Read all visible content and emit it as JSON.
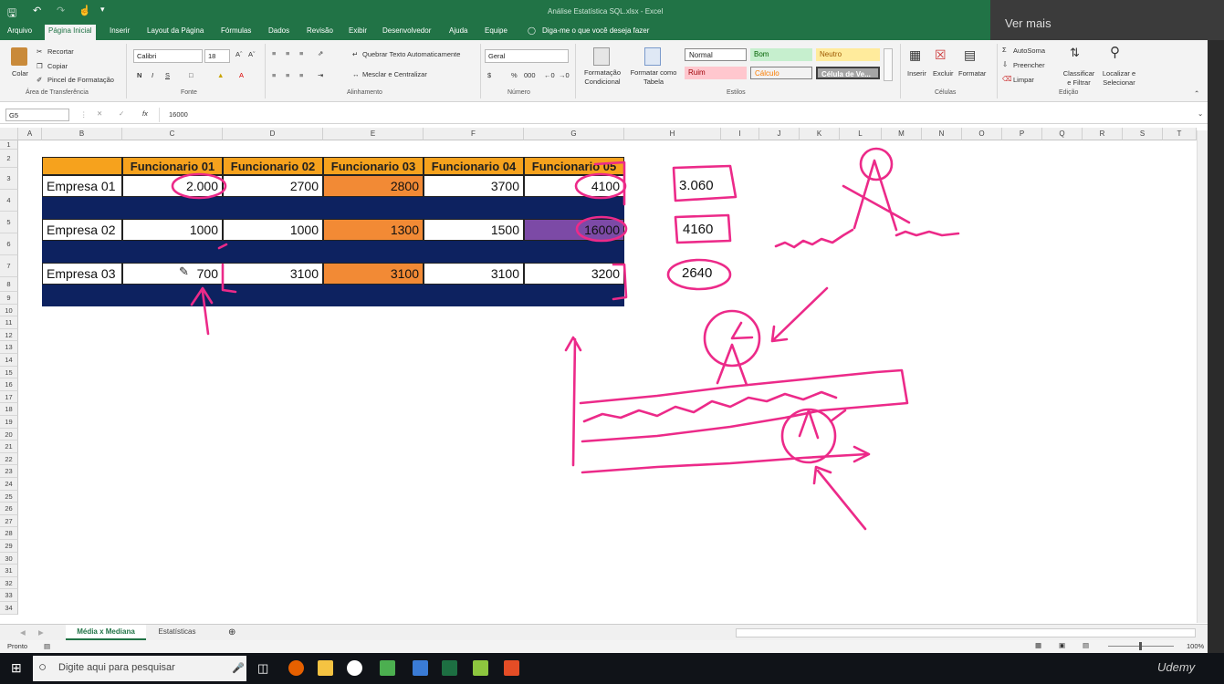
{
  "window": {
    "title": "Análise Estatística SQL.xlsx - Excel",
    "ver_mais": "Ver mais"
  },
  "ribbon_tabs": [
    "Arquivo",
    "Página Inicial",
    "Inserir",
    "Layout da Página",
    "Fórmulas",
    "Dados",
    "Revisão",
    "Exibir",
    "Desenvolvedor",
    "Ajuda",
    "Equipe"
  ],
  "tell_me": "Diga-me o que você deseja fazer",
  "clipboard": {
    "paste": "Colar",
    "cut": "Recortar",
    "copy": "Copiar",
    "format_painter": "Pincel de Formatação",
    "group": "Área de Transferência"
  },
  "font": {
    "name": "Calibri",
    "size": "18",
    "group": "Fonte"
  },
  "alignment": {
    "wrap": "Quebrar Texto Automaticamente",
    "merge": "Mesclar e Centralizar",
    "group": "Alinhamento"
  },
  "number": {
    "format": "Geral",
    "group": "Número"
  },
  "styles": {
    "cond_format": "Formatação Condicional",
    "format_table": "Formatar como Tabela",
    "normal": "Normal",
    "bom": "Bom",
    "neutro": "Neutro",
    "ruim": "Ruim",
    "calculo": "Cálculo",
    "celula": "Célula de Ve...",
    "group": "Estilos"
  },
  "cells": {
    "insert": "Inserir",
    "delete": "Excluir",
    "format": "Formatar",
    "group": "Células"
  },
  "editing": {
    "autosum": "AutoSoma",
    "fill": "Preencher",
    "clear": "Limpar",
    "sort": "Classificar e Filtrar",
    "find": "Localizar e Selecionar",
    "group": "Edição"
  },
  "formula_bar": {
    "name_box": "G5",
    "fx": "fx",
    "value": "16000"
  },
  "columns": [
    "A",
    "B",
    "C",
    "D",
    "E",
    "F",
    "G",
    "H",
    "I",
    "J",
    "K",
    "L",
    "M",
    "N",
    "O",
    "P",
    "Q",
    "R",
    "S",
    "T"
  ],
  "rows": [
    "1",
    "2",
    "3",
    "4",
    "5",
    "6",
    "7",
    "8",
    "9",
    "10",
    "11",
    "12",
    "13",
    "14",
    "15",
    "16",
    "17",
    "18",
    "19",
    "20",
    "21",
    "22",
    "23",
    "24",
    "25",
    "26",
    "27",
    "28",
    "29",
    "30",
    "31",
    "32",
    "33",
    "34"
  ],
  "table": {
    "headers": [
      "Funcionario 01",
      "Funcionario 02",
      "Funcionario 03",
      "Funcionario 04",
      "Funcionario 05"
    ],
    "rows": [
      {
        "label": "Empresa 01",
        "values": [
          "2.000",
          "2700",
          "2800",
          "3700",
          "4100"
        ]
      },
      {
        "label": "Empresa 02",
        "values": [
          "1000",
          "1000",
          "1300",
          "1500",
          "16000"
        ]
      },
      {
        "label": "Empresa 03",
        "values": [
          "700",
          "3100",
          "3100",
          "3100",
          "3200"
        ]
      }
    ]
  },
  "side_values": [
    "3.060",
    "4160",
    "2640"
  ],
  "sheet_tabs": [
    "Média x Mediana",
    "Estatísticas"
  ],
  "status": {
    "ready": "Pronto",
    "zoom": "100%"
  },
  "taskbar": {
    "search": "Digite aqui para pesquisar"
  },
  "watermark": "Udemy",
  "colors": {
    "excel_green": "#217346",
    "header_orange": "#f6a21d",
    "highlight_orange": "#f28a35",
    "highlight_purple": "#7c4aa6",
    "band_navy": "#0d2260",
    "ink_pink": "#ec2a89"
  }
}
